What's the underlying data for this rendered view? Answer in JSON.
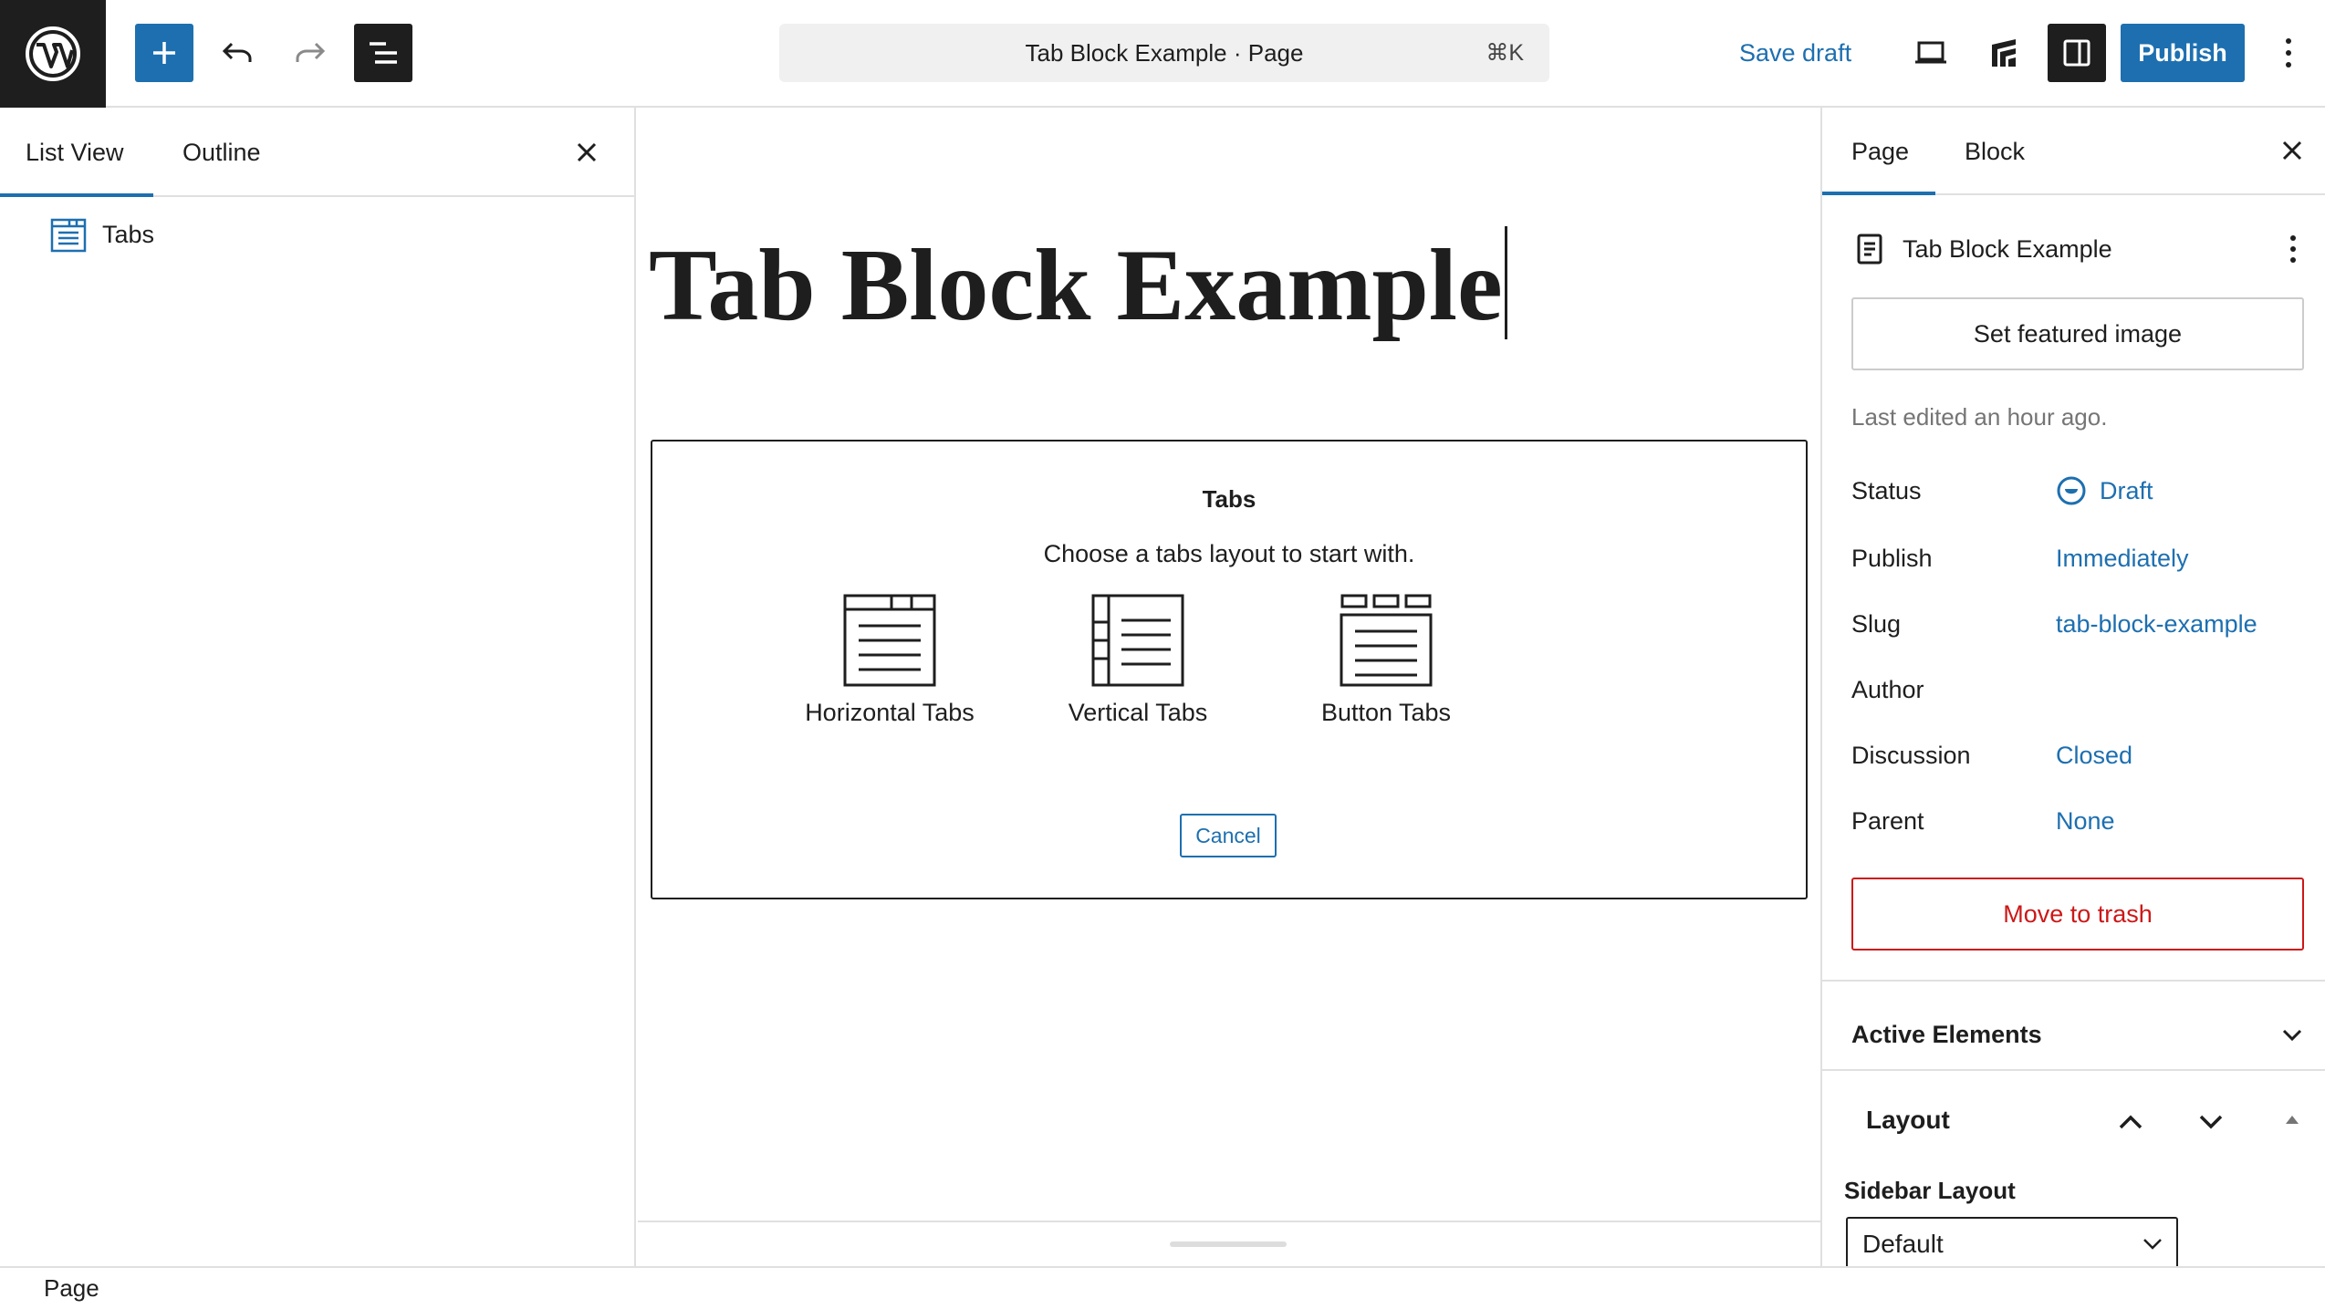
{
  "toolbar": {
    "command_title": "Tab Block Example · Page",
    "command_shortcut": "⌘K",
    "save_draft": "Save draft",
    "publish": "Publish",
    "icons": {
      "logo": "wordpress-logo",
      "add": "plus-icon",
      "undo": "undo-icon",
      "redo": "redo-icon",
      "tools": "document-overview-icon",
      "preview": "laptop-icon",
      "plugin": "plugin-icon",
      "settings": "sidebar-settings-icon",
      "options": "more-vertical-icon"
    }
  },
  "left_panel": {
    "tabs": [
      {
        "label": "List View"
      },
      {
        "label": "Outline"
      }
    ],
    "items": [
      {
        "label": "Tabs",
        "icon": "tabs-block-icon"
      }
    ]
  },
  "editor": {
    "title": "Tab Block Example",
    "placeholder": {
      "title": "Tabs",
      "instructions": "Choose a tabs layout to start with.",
      "variations": [
        {
          "label": "Horizontal Tabs",
          "icon": "horizontal-tabs-icon"
        },
        {
          "label": "Vertical Tabs",
          "icon": "vertical-tabs-icon"
        },
        {
          "label": "Button Tabs",
          "icon": "button-tabs-icon"
        }
      ],
      "cancel": "Cancel"
    }
  },
  "right_panel": {
    "tabs": [
      {
        "label": "Page"
      },
      {
        "label": "Block"
      }
    ],
    "document_title": "Tab Block Example",
    "featured_image": "Set featured image",
    "last_edited": "Last edited an hour ago.",
    "rows": [
      {
        "label": "Status",
        "value": "Draft"
      },
      {
        "label": "Publish",
        "value": "Immediately"
      },
      {
        "label": "Slug",
        "value": "tab-block-example"
      },
      {
        "label": "Author",
        "value": ""
      },
      {
        "label": "Discussion",
        "value": "Closed"
      },
      {
        "label": "Parent",
        "value": "None"
      }
    ],
    "trash": "Move to trash",
    "active_elements": "Active Elements",
    "layout": {
      "title": "Layout",
      "sidebar_label": "Sidebar Layout",
      "sidebar_value": "Default"
    }
  },
  "statusbar": {
    "breadcrumb": "Page"
  },
  "colors": {
    "accent": "#1d6fb0",
    "dark": "#1e1e1e",
    "danger": "#cc1818",
    "border": "#e0e0e0"
  }
}
